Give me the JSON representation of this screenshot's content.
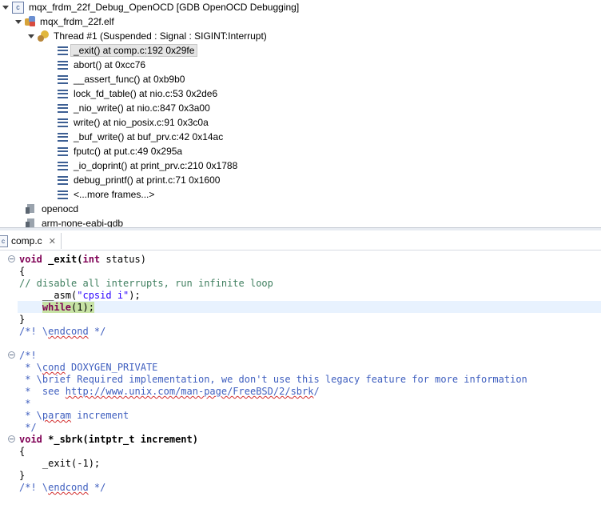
{
  "debug": {
    "launch": "mqx_frdm_22f_Debug_OpenOCD [GDB OpenOCD Debugging]",
    "elf": "mqx_frdm_22f.elf",
    "thread": "Thread #1 (Suspended : Signal : SIGINT:Interrupt)",
    "frames": [
      "_exit() at comp.c:192 0x29fe",
      "abort() at 0xcc76",
      "__assert_func() at 0xb9b0",
      "lock_fd_table() at nio.c:53 0x2de6",
      "_nio_write() at nio.c:847 0x3a00",
      "write() at nio_posix.c:91 0x3c0a",
      "_buf_write() at buf_prv.c:42 0x14ac",
      "fputc() at put.c:49 0x295a",
      "_io_doprint() at print_prv.c:210 0x1788",
      "debug_printf() at print.c:71 0x1600",
      "<...more frames...>"
    ],
    "process_1": "openocd",
    "process_2": "arm-none-eabi-gdb"
  },
  "editor": {
    "tab_label": "comp.c",
    "code": {
      "l1_kw": "void",
      "l1_fn": " _exit(",
      "l1_kw2": "int",
      "l1_rest": " status)",
      "l2": "{",
      "l3": "// disable all interrupts, run infinite loop",
      "l4_pre": "    __asm(",
      "l4_str": "\"cpsid i\"",
      "l4_post": ");",
      "l5_pre": "    ",
      "l5_kw": "while",
      "l5_rest": "(1);",
      "l6": "}",
      "l7_a": "/*! \\",
      "l7_b": "endcond",
      "l7_c": " */",
      "l9": "/*!",
      "l10_a": " * \\",
      "l10_b": "cond",
      "l10_c": " DOXYGEN_PRIVATE",
      "l11": " * \\brief Required implementation, we don't use this legacy feature for more information",
      "l12_a": " *  see ",
      "l12_b": "http://www.unix.com/man-page/FreeBSD/2/",
      "l12_c": "sbrk",
      "l12_d": "/",
      "l13": " *",
      "l14_a": " * \\",
      "l14_b": "param",
      "l14_c": " increment",
      "l15": " */",
      "l16_kw": "void",
      "l16_rest": " *_sbrk(intptr_t increment)",
      "l17": "{",
      "l18": "    _exit(-1);",
      "l19": "}",
      "l20_a": "/*! \\",
      "l20_b": "endcond",
      "l20_c": " */"
    }
  }
}
